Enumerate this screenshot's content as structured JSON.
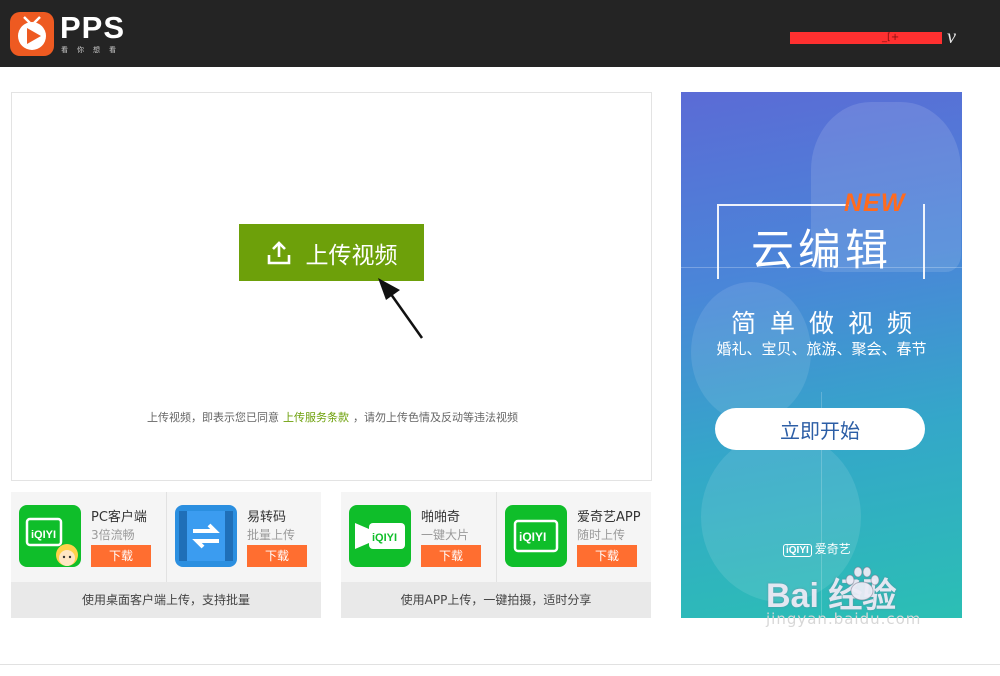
{
  "header": {
    "brand": "PPS",
    "slogan": "看你想看",
    "user_suffix": "v",
    "user_redacted_fragment": "_[+"
  },
  "upload": {
    "button_label": "上传视频",
    "terms_prefix": "上传视频，即表示您已同意",
    "terms_link": "上传服务条款",
    "terms_suffix": "，请勿上传色情及反动等违法视频"
  },
  "desktop_clients": {
    "footer": "使用桌面客户端上传，支持批量",
    "items": [
      {
        "name": "PC客户端",
        "desc": "3倍流畅",
        "button": "下载",
        "icon": "iqiyi-pc-icon",
        "icon_text": "iQIYI"
      },
      {
        "name": "易转码",
        "desc": "批量上传",
        "button": "下载",
        "icon": "convert-arrows-icon"
      }
    ]
  },
  "mobile_apps": {
    "footer": "使用APP上传，一键拍摄，适时分享",
    "items": [
      {
        "name": "啪啪奇",
        "desc": "一键大片",
        "button": "下载",
        "icon": "papaqi-icon",
        "icon_text": "iQIYI"
      },
      {
        "name": "爱奇艺APP",
        "desc": "随时上传",
        "button": "下载",
        "icon": "iqiyi-app-icon",
        "icon_text": "iQIYI"
      }
    ]
  },
  "ad": {
    "badge": "NEW",
    "title": "云编辑",
    "subtitle": "简单做视频",
    "tags": "婚礼、宝贝、旅游、聚会、春节",
    "start_button": "立即开始",
    "logo_box": "iQIYI",
    "logo_text": "爱奇艺"
  },
  "watermark": {
    "main": "Bai  经验",
    "url": "jingyan.baidu.com"
  },
  "colors": {
    "header_bg": "#242424",
    "brand_orange": "#ee5a21",
    "upload_green": "#6da00a",
    "download_orange": "#ff6e30",
    "iqiyi_green": "#0fbe2a"
  }
}
